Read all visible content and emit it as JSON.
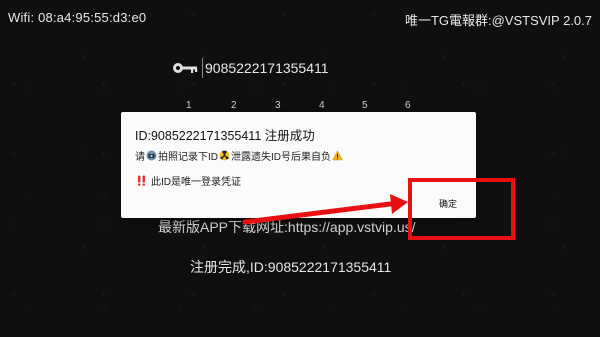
{
  "status": {
    "wifi": "Wifi: 08:a4:95:55:d3:e0",
    "brand": "唯一TG電報群:@VSTSVIP  2.0.7"
  },
  "login": {
    "id_value": "9085222171355411",
    "digits": [
      "1",
      "2",
      "3",
      "4",
      "5",
      "6"
    ]
  },
  "footer": {
    "url_hint": "最新版APP下载网址:https://app.vstvip.us/",
    "done_text": "注册完成,ID:9085222171355411"
  },
  "dialog": {
    "title": "ID:9085222171355411 注册成功",
    "line1_a": "请",
    "line1_b": "拍照记录下ID",
    "line1_c": "泄露遗失ID号后果自负",
    "line2": "此ID是唯一登录凭证",
    "ok_label": "确定"
  },
  "annotation": {
    "color": "#e81010"
  }
}
